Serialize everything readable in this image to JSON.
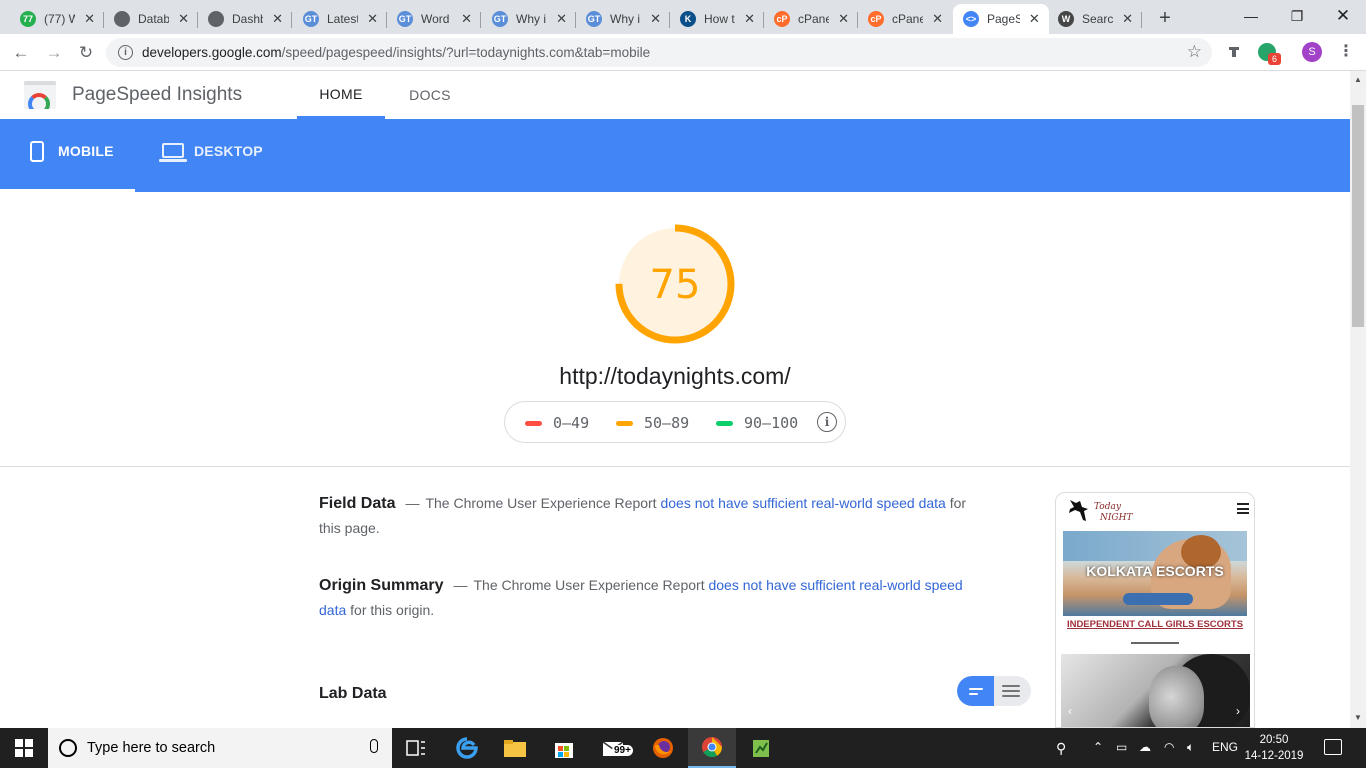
{
  "browser": {
    "tabs": [
      {
        "title": "(77) W",
        "fav_color": "#25b04f",
        "fav_text": "77"
      },
      {
        "title": "Datab",
        "fav_color": "#5f6368",
        "fav_text": ""
      },
      {
        "title": "Dashb",
        "fav_color": "#5f6368",
        "fav_text": ""
      },
      {
        "title": "Latest",
        "fav_color": "#5a8ed8",
        "fav_text": "GT"
      },
      {
        "title": "Word",
        "fav_color": "#5a8ed8",
        "fav_text": "GT"
      },
      {
        "title": "Why i",
        "fav_color": "#5a8ed8",
        "fav_text": "GT"
      },
      {
        "title": "Why i",
        "fav_color": "#5a8ed8",
        "fav_text": "GT"
      },
      {
        "title": "How t",
        "fav_color": "#0b4f8a",
        "fav_text": "K"
      },
      {
        "title": "cPane",
        "fav_color": "#ff6c2c",
        "fav_text": "cP"
      },
      {
        "title": "cPane",
        "fav_color": "#ff6c2c",
        "fav_text": "cP"
      },
      {
        "title": "PageS",
        "fav_color": "#4285f4",
        "fav_text": "<>"
      },
      {
        "title": "Searc",
        "fav_color": "#464646",
        "fav_text": "W"
      }
    ],
    "url_host": "developers.google.com",
    "url_path": "/speed/pagespeed/insights/?url=todaynights.com&tab=mobile",
    "ext_badge": "6",
    "profile_initial": "S"
  },
  "header": {
    "title": "PageSpeed Insights",
    "nav": [
      "HOME",
      "DOCS"
    ]
  },
  "device_tabs": {
    "mobile": "MOBILE",
    "desktop": "DESKTOP"
  },
  "score": {
    "value": "75",
    "fraction": 0.75,
    "color": "#ffa400",
    "url": "http://todaynights.com/"
  },
  "legend": [
    {
      "range": "0–49",
      "color": "#ff4e42"
    },
    {
      "range": "50–89",
      "color": "#ffa400"
    },
    {
      "range": "90–100",
      "color": "#0cce6b"
    }
  ],
  "field_data": {
    "title": "Field Data",
    "text_pre": "The Chrome User Experience Report",
    "link": "does not have sufficient real-world speed data",
    "text_post": "for this page."
  },
  "origin_summary": {
    "title": "Origin Summary",
    "text_pre": "The Chrome User Experience Report",
    "link": "does not have sufficient real-world speed data",
    "text_post": "for this origin."
  },
  "lab_data": {
    "title": "Lab Data"
  },
  "thumbnail": {
    "logo_text": "Today NIGHT",
    "hero_text": "KOLKATA ESCORTS",
    "sub_text": "INDEPENDENT CALL GIRLS ESCORTS"
  },
  "taskbar": {
    "search_placeholder": "Type here to search",
    "mail_badge": "99+",
    "language": "ENG",
    "time": "20:50",
    "date": "14-12-2019"
  }
}
